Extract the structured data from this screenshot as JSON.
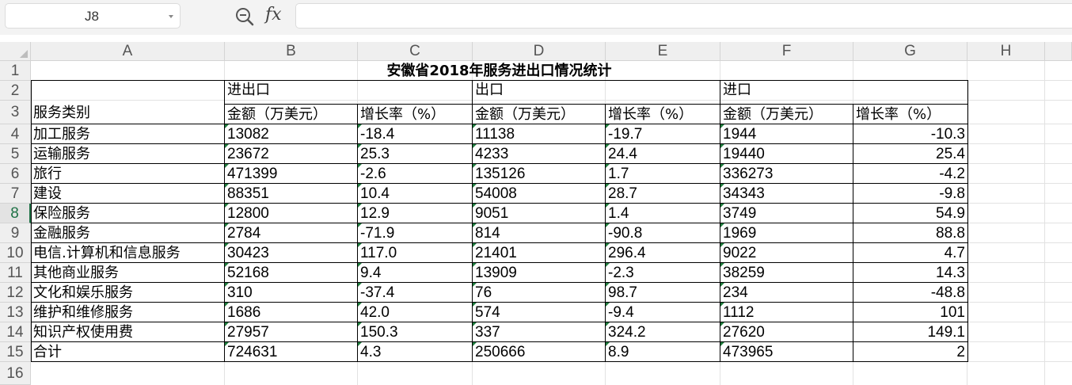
{
  "formula_bar": {
    "name_box": "J8",
    "fx_label": "fx",
    "formula_value": ""
  },
  "columns": [
    "A",
    "B",
    "C",
    "D",
    "E",
    "F",
    "G",
    "H"
  ],
  "rows": [
    "1",
    "2",
    "3",
    "4",
    "5",
    "6",
    "7",
    "8",
    "9",
    "10",
    "11",
    "12",
    "13",
    "14",
    "15",
    "16"
  ],
  "active_row": "8",
  "sheet": {
    "title": "安徽省2018年服务进出口情况统计",
    "row2": {
      "label": "服务类别",
      "group_total": "进出口",
      "group_export": "出口",
      "group_import": "进口"
    },
    "row3": [
      "金额（万美元）",
      "增长率（%）",
      "金额（万美元）",
      "增长率（%）",
      "金额（万美元）",
      "增长率（%）"
    ],
    "data": [
      [
        "加工服务",
        "13082",
        "-18.4",
        "11138",
        "-19.7",
        "1944",
        "-10.3"
      ],
      [
        "运输服务",
        "23672",
        "25.3",
        "4233",
        "24.4",
        "19440",
        "25.4"
      ],
      [
        "旅行",
        "471399",
        "-2.6",
        "135126",
        "1.7",
        "336273",
        "-4.2"
      ],
      [
        "建设",
        "88351",
        "10.4",
        "54008",
        "28.7",
        "34343",
        "-9.8"
      ],
      [
        "保险服务",
        "12800",
        "12.9",
        "9051",
        "1.4",
        "3749",
        "54.9"
      ],
      [
        "金融服务",
        "2784",
        "-71.9",
        "814",
        "-90.8",
        "1969",
        "88.8"
      ],
      [
        "电信.计算机和信息服务",
        "30423",
        "117.0",
        "21401",
        "296.4",
        "9022",
        "4.7"
      ],
      [
        "其他商业服务",
        "52168",
        "9.4",
        "13909",
        "-2.3",
        "38259",
        "14.3"
      ],
      [
        "文化和娱乐服务",
        "310",
        "-37.4",
        "76",
        "98.7",
        "234",
        "-48.8"
      ],
      [
        "维护和维修服务",
        "1686",
        "42.0",
        "574",
        "-9.4",
        "1112",
        "101"
      ],
      [
        "知识产权使用费",
        "27957",
        "150.3",
        "337",
        "324.2",
        "27620",
        "149.1"
      ],
      [
        "合计",
        "724631",
        "4.3",
        "250666",
        "8.9",
        "473965",
        "2"
      ]
    ]
  },
  "colors": {
    "accent": "#1e7145",
    "error_tick": "#1e7b3c",
    "header_bg": "#efefef"
  }
}
